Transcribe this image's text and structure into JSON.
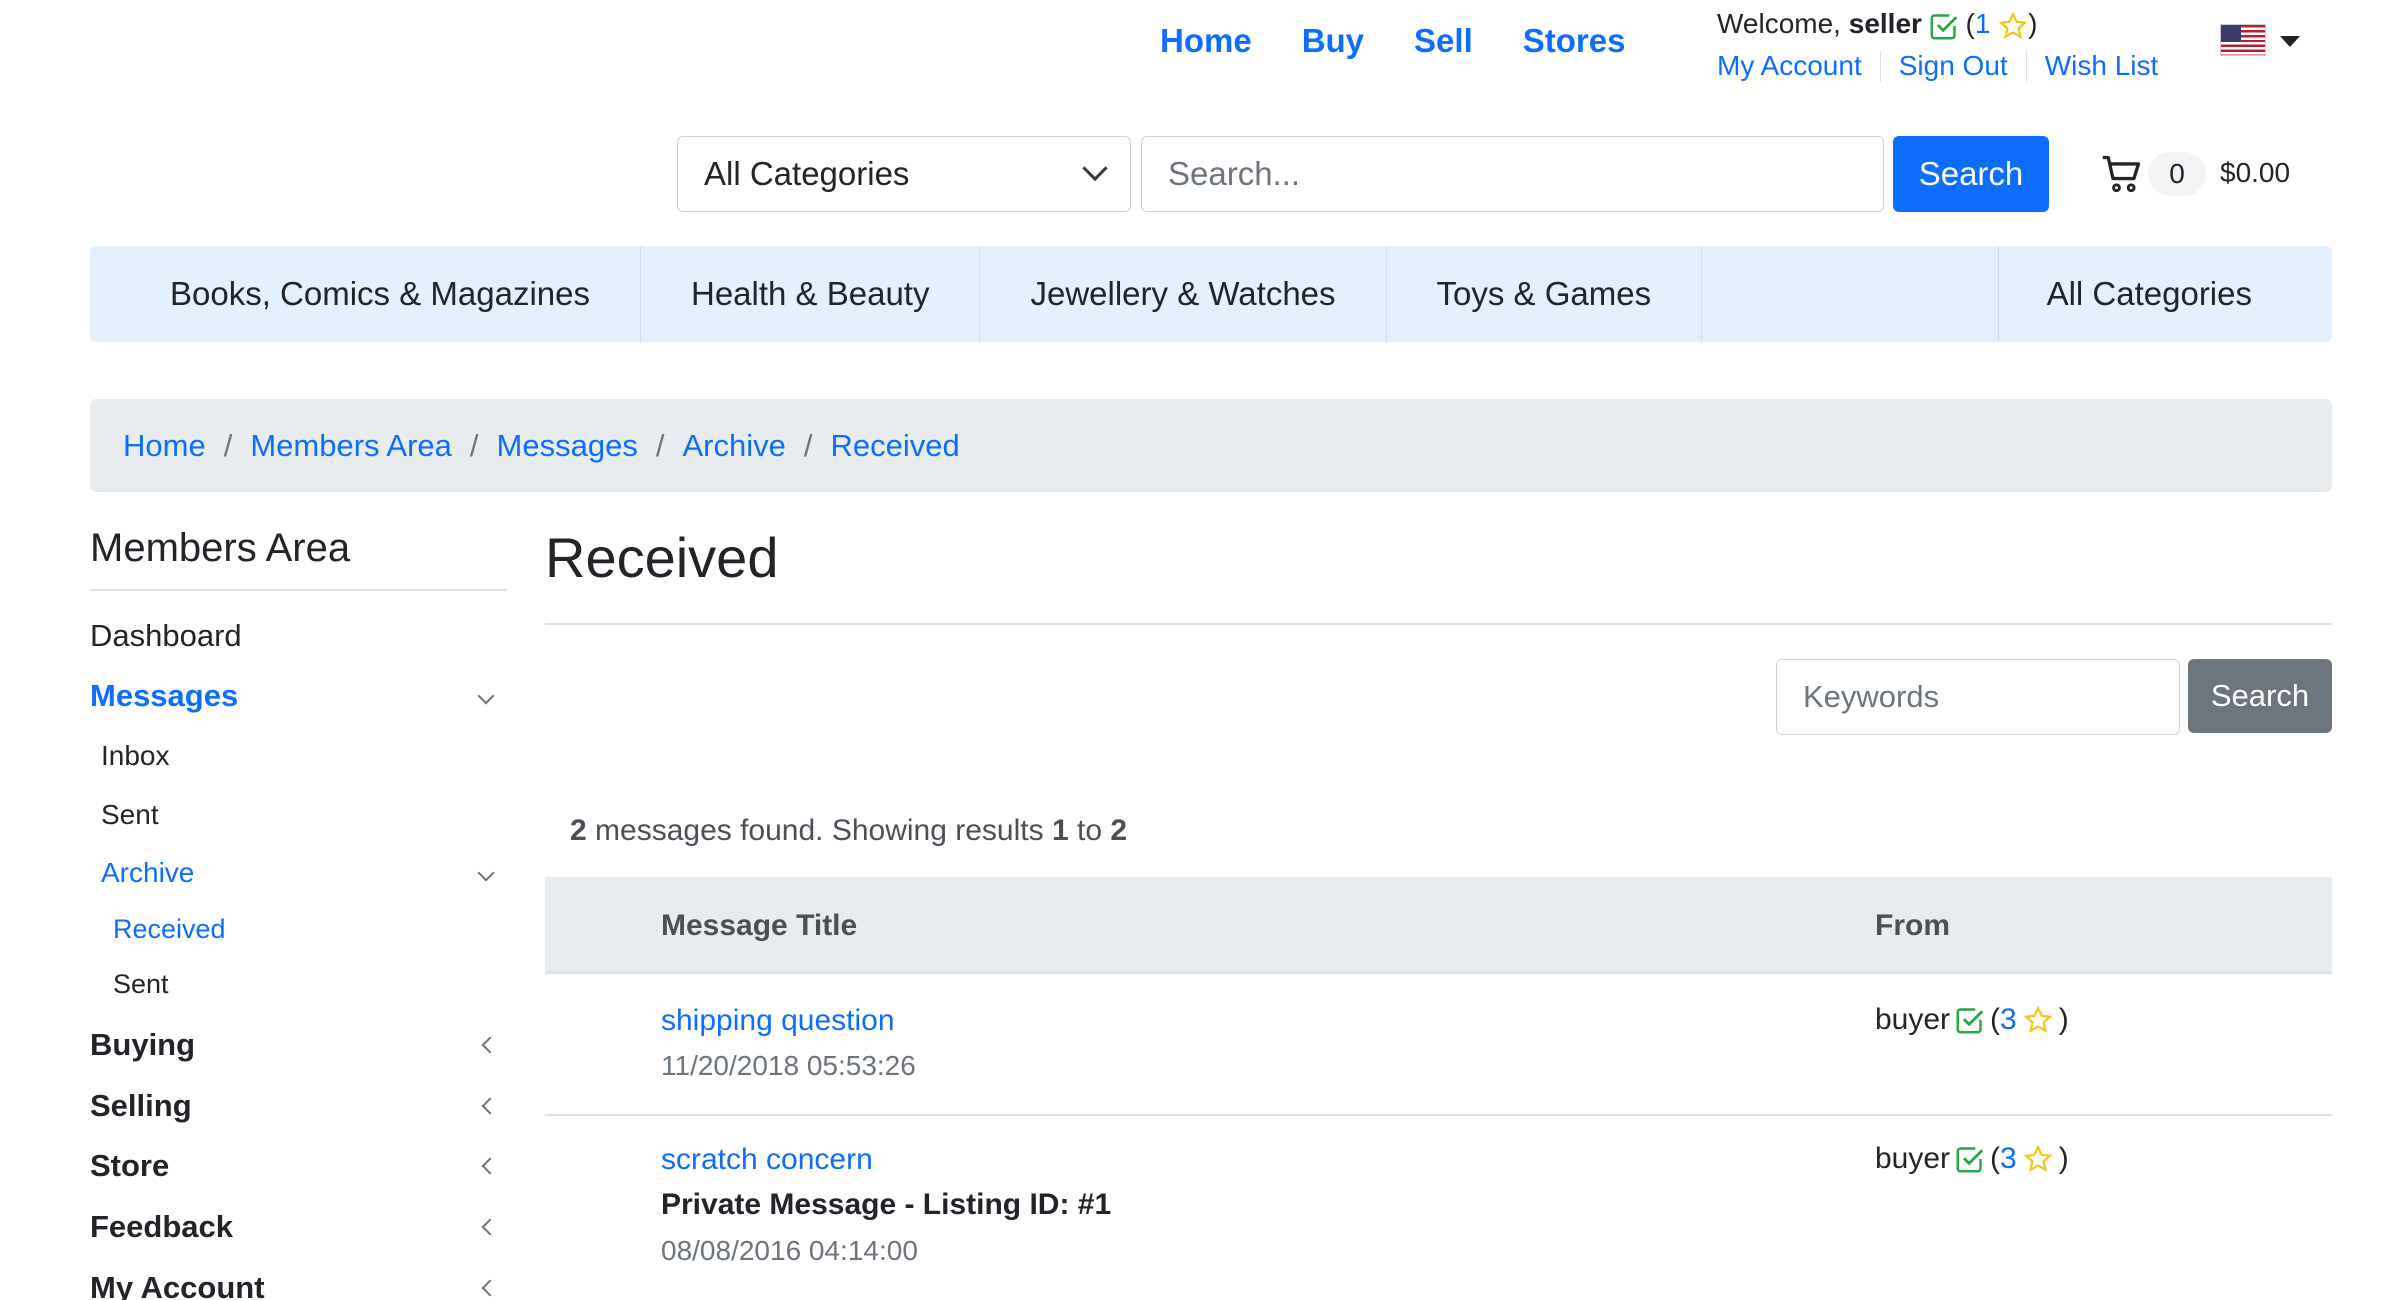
{
  "topnav": {
    "home": "Home",
    "buy": "Buy",
    "sell": "Sell",
    "stores": "Stores"
  },
  "user": {
    "welcome_prefix": "Welcome,",
    "username": "seller",
    "rating_open": "(",
    "rating_count": "1",
    "rating_close": ")",
    "links": {
      "my_account": "My Account",
      "sign_out": "Sign Out",
      "wish_list": "Wish List"
    }
  },
  "search": {
    "category_selected": "All Categories",
    "placeholder": "Search...",
    "button": "Search"
  },
  "cart": {
    "count": "0",
    "total": "$0.00"
  },
  "categories": {
    "books": "Books, Comics & Magazines",
    "health": "Health & Beauty",
    "jewellery": "Jewellery & Watches",
    "toys": "Toys & Games",
    "all": "All Categories"
  },
  "breadcrumb": {
    "items": [
      "Home",
      "Members Area",
      "Messages",
      "Archive",
      "Received"
    ],
    "separator": "/"
  },
  "sidebar": {
    "title": "Members Area",
    "dashboard": "Dashboard",
    "messages": "Messages",
    "inbox": "Inbox",
    "sent": "Sent",
    "archive": "Archive",
    "archive_received": "Received",
    "archive_sent": "Sent",
    "buying": "Buying",
    "selling": "Selling",
    "store": "Store",
    "feedback": "Feedback",
    "my_account": "My Account"
  },
  "main": {
    "title": "Received",
    "keywords_placeholder": "Keywords",
    "search_button": "Search",
    "results": {
      "count": "2",
      "text1": "messages found. Showing results",
      "from": "1",
      "to_word": "to",
      "to": "2"
    },
    "columns": {
      "title": "Message Title",
      "from": "From"
    },
    "messages": [
      {
        "title": "shipping question",
        "subtitle": "",
        "date": "11/20/2018 05:53:26",
        "from": "buyer",
        "rating_open": "(",
        "rating": "3",
        "rating_close": ")"
      },
      {
        "title": "scratch concern",
        "subtitle": "Private Message - Listing ID: #1",
        "date": "08/08/2016 04:14:00",
        "from": "buyer",
        "rating_open": "(",
        "rating": "3",
        "rating_close": ")"
      }
    ]
  },
  "colors": {
    "primary": "#0d6efd",
    "secondary": "#6c757d",
    "category_bar": "#e3f0fd",
    "breadcrumb_bg": "#e9ecef",
    "verified_green": "#28a745",
    "star_yellow": "#f5c518"
  },
  "icons": {
    "verified": "check-square-icon",
    "rating": "star-icon",
    "cart": "cart-icon",
    "flag": "us-flag-icon"
  }
}
